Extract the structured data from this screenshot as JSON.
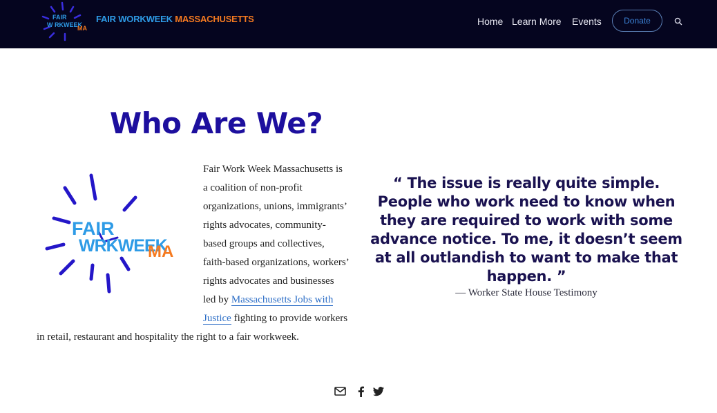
{
  "header": {
    "logo_mark_text": {
      "line1": "FAIR",
      "line2": "W  RKWEEK",
      "line3": "MA"
    },
    "logo_text_part1": "FAIR WORKWEEK ",
    "logo_text_part2": "MASSACHUSETTS",
    "nav": [
      {
        "label": "Home"
      },
      {
        "label": "Learn More"
      },
      {
        "label": "Events"
      }
    ],
    "donate_label": "Donate",
    "search_icon": "search-icon"
  },
  "main": {
    "title": "Who Are We?",
    "logo": {
      "line1": "FAIR",
      "line2": "WRKWEEK",
      "line3": "MA"
    },
    "paragraph_before_link": "Fair Work Week Massachusetts is a coalition of non-profit organizations, unions, immigrants’ rights advocates, community-based groups and collectives, faith-based organizations, workers’ rights advocates and businesses led by ",
    "link_text": "Massachusetts Jobs with Justice",
    "paragraph_after_link": " fighting to provide workers in retail, restaurant and hospitality the right to a fair workweek.",
    "quote": "“ The issue is really quite simple. People who work need to know when they are required to work with some advance notice. To me, it doesn’t seem at all outlandish to want to make that happen. ”",
    "attribution": "— Worker State House Testimony"
  },
  "share": {
    "icons": [
      "mail-icon",
      "facebook-icon",
      "twitter-icon"
    ]
  },
  "colors": {
    "header_bg": "#05051f",
    "title": "#1d0f9e",
    "logo_blue": "#2e9be6",
    "logo_orange": "#f57a20",
    "link": "#2e6fc7"
  }
}
